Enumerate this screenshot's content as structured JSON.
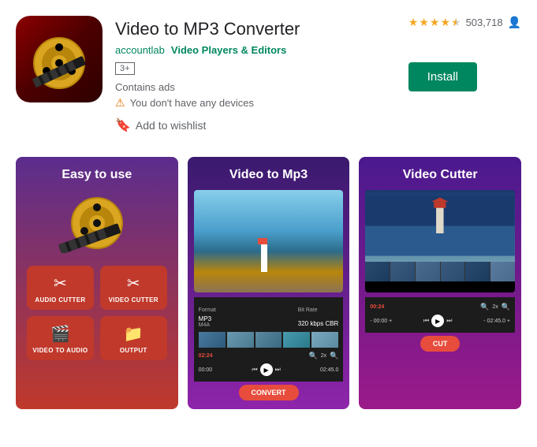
{
  "app": {
    "title": "Video to MP3 Converter",
    "developer": "accountlab",
    "category": "Video Players & Editors",
    "rating_count": "503,718",
    "age_rating": "3+",
    "contains_ads": "Contains ads",
    "warning": "You don't have any devices",
    "wishlist": "Add to wishlist",
    "install_label": "Install",
    "stars_full": 4,
    "stars_half": 1
  },
  "screenshots": [
    {
      "title": "Easy to use",
      "buttons": [
        {
          "label": "AUDIO CUTTER",
          "icon": "✂"
        },
        {
          "label": "VIDEO CUTTER",
          "icon": "✂"
        },
        {
          "label": "VIDEO TO AUDIO",
          "icon": "🎬"
        },
        {
          "label": "OUTPUT",
          "icon": "📁"
        }
      ]
    },
    {
      "title": "Video to Mp3",
      "format_label": "Format",
      "format_value": "MP3",
      "bitrate_label": "Bit Rate",
      "bitrate_value": "320 kbps CBR",
      "time_start": "00:00",
      "time_end": "02:45.0",
      "convert_label": "CONVERT"
    },
    {
      "title": "Video Cutter",
      "time_start": "00:24",
      "time_in": "- 00:00 +",
      "time_out": "- 02:45.0 +",
      "cut_label": "CUT"
    }
  ]
}
